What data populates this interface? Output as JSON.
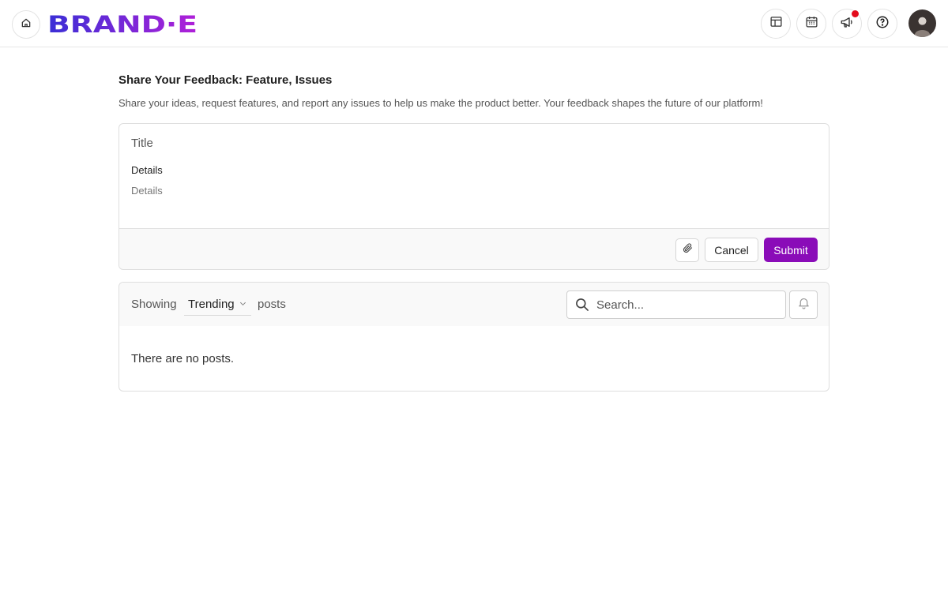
{
  "header": {
    "brand": "BRAND·E",
    "icons": [
      "home-icon",
      "layout-icon",
      "calendar-icon",
      "megaphone-icon",
      "help-icon"
    ],
    "notification_color": "#e30b1c",
    "brand_gradient": [
      "#3a2fd6",
      "#b020d8"
    ]
  },
  "main": {
    "title": "Share Your Feedback: Feature, Issues",
    "subtitle": "Share your ideas, request features, and report any issues to help us make the product better. Your feedback shapes the future of our platform!"
  },
  "composer": {
    "title_placeholder": "Title",
    "details_label": "Details",
    "details_placeholder": "Details",
    "cancel_label": "Cancel",
    "submit_label": "Submit",
    "accent_color": "#8a0cb8"
  },
  "posts": {
    "showing_label": "Showing",
    "sort_value": "Trending",
    "posts_label": "posts",
    "search_placeholder": "Search...",
    "empty_message": "There are no posts."
  }
}
